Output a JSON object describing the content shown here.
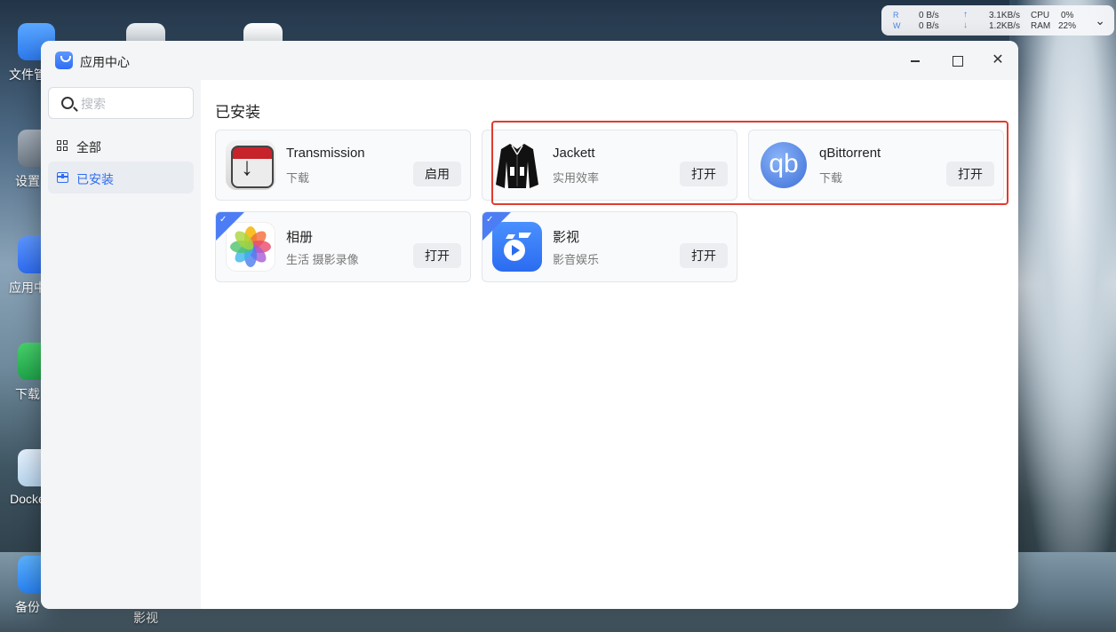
{
  "desktop": {
    "icons": [
      {
        "label": "文件管"
      },
      {
        "label": "设置"
      },
      {
        "label": "应用中"
      },
      {
        "label": "下载"
      },
      {
        "label": "Docke"
      },
      {
        "label": "备份"
      }
    ],
    "bottom_label": "影视"
  },
  "monitor": {
    "r_letter": "R",
    "w_letter": "W",
    "read": "0 B/s",
    "write": "0 B/s",
    "upload": "3.1KB/s",
    "download": "1.2KB/s",
    "cpu_label": "CPU",
    "cpu_value": "0%",
    "ram_label": "RAM",
    "ram_value": "22%",
    "up_arrow": "↑",
    "down_arrow": "↓",
    "chevron": "⌄"
  },
  "window": {
    "title": "应用中心",
    "close_glyph": "✕"
  },
  "sidebar": {
    "search_placeholder": "搜索",
    "items": [
      {
        "label": "全部"
      },
      {
        "label": "已安装"
      }
    ]
  },
  "main": {
    "section_title": "已安装",
    "apps": [
      {
        "name": "Transmission",
        "category": "下载",
        "button": "启用",
        "icon": "transmission-icon"
      },
      {
        "name": "Jackett",
        "category": "实用效率",
        "button": "打开",
        "icon": "jackett-icon"
      },
      {
        "name": "qBittorrent",
        "category": "下载",
        "button": "打开",
        "icon": "qbittorrent-icon",
        "icon_text": "qb"
      },
      {
        "name": "相册",
        "category": "生活 摄影录像",
        "button": "打开",
        "icon": "photos-icon",
        "ribbon": true
      },
      {
        "name": "影视",
        "category": "影音娱乐",
        "button": "打开",
        "icon": "video-icon",
        "ribbon": true
      }
    ]
  },
  "colors": {
    "accent": "#2f6df3",
    "highlight": "#e23b2e"
  }
}
